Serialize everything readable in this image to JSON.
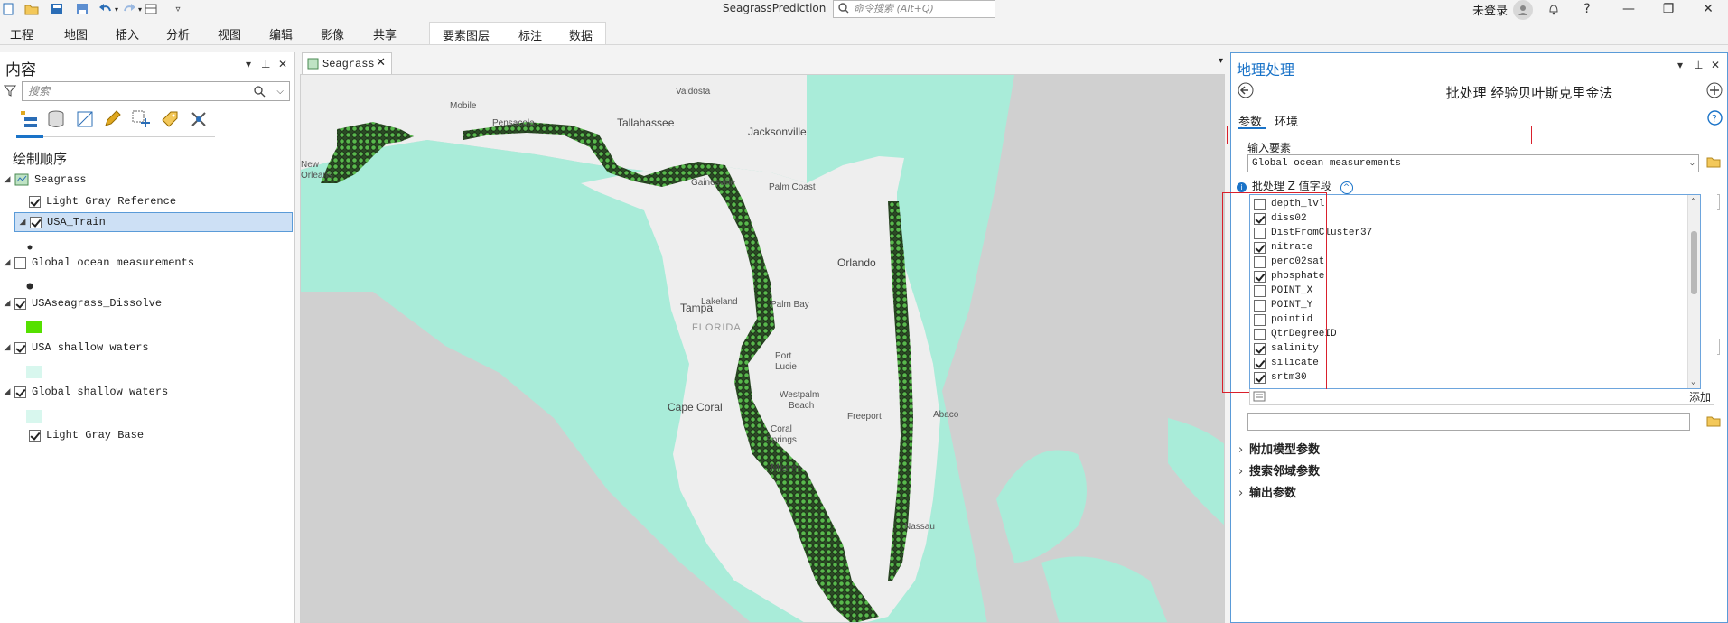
{
  "app": {
    "title": "SeagrassPrediction",
    "command_search_placeholder": "命令搜索 (Alt+Q)",
    "signin": "未登录",
    "help": "?"
  },
  "ribbon": {
    "tabs": [
      "工程",
      "地图",
      "插入",
      "分析",
      "视图",
      "编辑",
      "影像",
      "共享"
    ],
    "contextual_tabs": [
      "要素图层",
      "标注",
      "数据"
    ]
  },
  "contents": {
    "title": "内容",
    "search_placeholder": "搜索",
    "drawing_order_label": "绘制顺序",
    "map_name": "Seagrass",
    "layers": [
      {
        "name": "Light Gray Reference",
        "checked": true
      },
      {
        "name": "USA_Train",
        "checked": true,
        "selected": true
      },
      {
        "name": "Global ocean measurements",
        "checked": false
      },
      {
        "name": "USAseagrass_Dissolve",
        "checked": true
      },
      {
        "name": "USA shallow waters",
        "checked": true
      },
      {
        "name": "Global shallow waters",
        "checked": true
      },
      {
        "name": "Light Gray Base",
        "checked": true
      }
    ],
    "colors": {
      "train_point": "#2b2b2b",
      "dissolve_fill": "#55e000",
      "shallow_fill": "#d8f7ee"
    }
  },
  "map": {
    "tab_label": "Seagrass",
    "colors": {
      "water": "#a9ecd9",
      "land": "#eeeeee",
      "deep": "#d0d0d0",
      "points": "#4fa34a"
    },
    "labels": {
      "valdosta": "Valdosta",
      "mobile": "Mobile",
      "pensacola": "Pensacola",
      "tallahassee": "Tallahassee",
      "jacksonville": "Jacksonville",
      "new_orleans_1": "New",
      "new_orleans_2": "Orleans",
      "gainesville": "Gainesville",
      "palm_coast": "Palm Coast",
      "orlando": "Orlando",
      "lakeland": "Lakeland",
      "tampa": "Tampa",
      "florida": "FLORIDA",
      "palm_bay": "Palm Bay",
      "port_lucie_1": "Port",
      "port_lucie_2": "Lucie",
      "west_palm_1": "Westpalm",
      "west_palm_2": "Beach",
      "cape_coral": "Cape Coral",
      "coral_springs_1": "Coral",
      "coral_springs_2": "Springs",
      "freeport": "Freeport",
      "abaco": "Abaco",
      "miami": "Miami",
      "nassau": "Nassau"
    }
  },
  "geoprocessing": {
    "title": "地理处理",
    "tool_name": "批处理 经验贝叶斯克里金法",
    "tabs": [
      "参数",
      "环境"
    ],
    "input_label": "输入要素",
    "input_value": "Global ocean measurements",
    "z_field_label": "批处理 Z 值字段",
    "fields": [
      {
        "name": "depth_lvl",
        "checked": false
      },
      {
        "name": "diss02",
        "checked": true
      },
      {
        "name": "DistFromCluster37",
        "checked": false
      },
      {
        "name": "nitrate",
        "checked": true
      },
      {
        "name": "perc02sat",
        "checked": false
      },
      {
        "name": "phosphate",
        "checked": true
      },
      {
        "name": "POINT_X",
        "checked": false
      },
      {
        "name": "POINT_Y",
        "checked": false
      },
      {
        "name": "pointid",
        "checked": false
      },
      {
        "name": "QtrDegreeID",
        "checked": false
      },
      {
        "name": "salinity",
        "checked": true
      },
      {
        "name": "silicate",
        "checked": true
      },
      {
        "name": "srtm30",
        "checked": true
      }
    ],
    "add_label": "添加",
    "sections": [
      "附加模型参数",
      "搜索邻域参数",
      "输出参数"
    ],
    "highlight_color": "#d9202c"
  }
}
